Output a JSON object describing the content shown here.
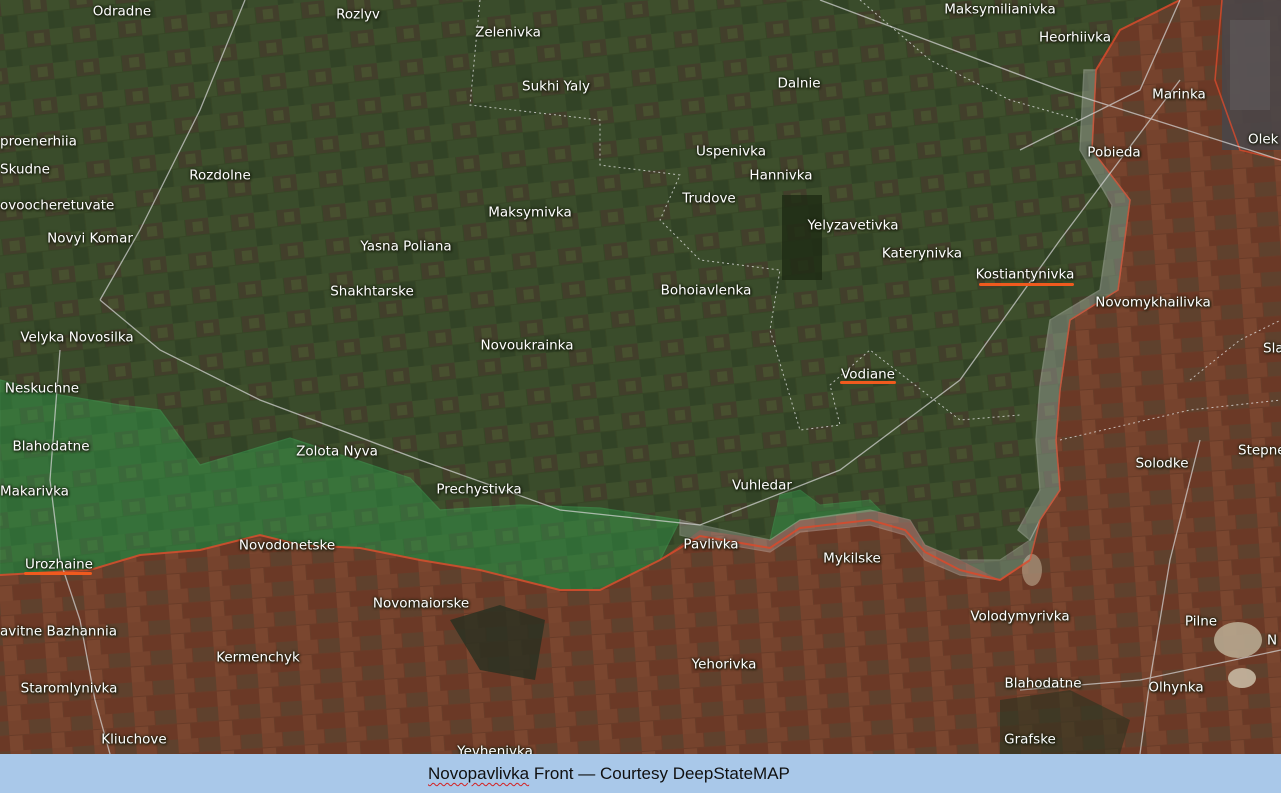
{
  "caption": {
    "emphasis": "Novopavlivka",
    "rest": " Front — Courtesy DeepStateMAP"
  },
  "colors": {
    "occupied_red": "#c9402c",
    "liberated_green": "#31c25a",
    "contested_grey": "#9a9a9a",
    "highlight_underline": "#f05a1e",
    "caption_background": "#a9c8e9"
  },
  "places": [
    {
      "id": "odradne",
      "name": "Odradne"
    },
    {
      "id": "rozlyv",
      "name": "Rozlyv"
    },
    {
      "id": "zelenivka",
      "name": "Zelenivka"
    },
    {
      "id": "maksymilianivka",
      "name": "Maksymilianivka"
    },
    {
      "id": "heorhiivka",
      "name": "Heorhiivka"
    },
    {
      "id": "sukhi-yaly",
      "name": "Sukhi Yaly"
    },
    {
      "id": "dalnie",
      "name": "Dalnie"
    },
    {
      "id": "marinka",
      "name": "Marinka"
    },
    {
      "id": "prosenerhiia",
      "name": "proenerhiia"
    },
    {
      "id": "olek",
      "name": "Olek"
    },
    {
      "id": "uspenivka",
      "name": "Uspenivka"
    },
    {
      "id": "pobieda",
      "name": "Pobieda"
    },
    {
      "id": "skudne",
      "name": "Skudne"
    },
    {
      "id": "rozdolne",
      "name": "Rozdolne"
    },
    {
      "id": "hannivka",
      "name": "Hannivka"
    },
    {
      "id": "trudove",
      "name": "Trudove"
    },
    {
      "id": "novoocheretuvate",
      "name": "ovoocheretuvate"
    },
    {
      "id": "maksymivka",
      "name": "Maksymivka"
    },
    {
      "id": "yelyzavetivka",
      "name": "Yelyzavetivka"
    },
    {
      "id": "novyi-komar",
      "name": "Novyi Komar"
    },
    {
      "id": "yasna-poliana",
      "name": "Yasna Poliana"
    },
    {
      "id": "katerynivka",
      "name": "Katerynivka"
    },
    {
      "id": "kostiantynivka",
      "name": "Kostiantynivka"
    },
    {
      "id": "shakhtarske",
      "name": "Shakhtarske"
    },
    {
      "id": "bohoiavlenka",
      "name": "Bohoiavlenka"
    },
    {
      "id": "novomykhailivka",
      "name": "Novomykhailivka"
    },
    {
      "id": "velyka-novosilka",
      "name": "Velyka Novosilka"
    },
    {
      "id": "novoukrainka",
      "name": "Novoukrainka"
    },
    {
      "id": "sla",
      "name": "Sla"
    },
    {
      "id": "vodiane",
      "name": "Vodiane"
    },
    {
      "id": "neskuchne",
      "name": "Neskuchne"
    },
    {
      "id": "blahodatne-west",
      "name": "Blahodatne"
    },
    {
      "id": "zolota-nyva",
      "name": "Zolota Nyva"
    },
    {
      "id": "solodke",
      "name": "Solodke"
    },
    {
      "id": "stepne",
      "name": "Stepne"
    },
    {
      "id": "prechystivka",
      "name": "Prechystivka"
    },
    {
      "id": "vuhledar",
      "name": "Vuhledar"
    },
    {
      "id": "makarivka",
      "name": "Makarivka"
    },
    {
      "id": "novodonetske",
      "name": "Novodonetske"
    },
    {
      "id": "pavlivka",
      "name": "Pavlivka"
    },
    {
      "id": "mykilske",
      "name": "Mykilske"
    },
    {
      "id": "urozhaine",
      "name": "Urozhaine"
    },
    {
      "id": "novomaiorske",
      "name": "Novomaiorske"
    },
    {
      "id": "volodymyrivka",
      "name": "Volodymyrivka"
    },
    {
      "id": "zavitne-bazhannia",
      "name": "avitne Bazhannia"
    },
    {
      "id": "pilne",
      "name": "Pilne"
    },
    {
      "id": "kermenchyk",
      "name": "Kermenchyk"
    },
    {
      "id": "yehorivka",
      "name": "Yehorivka"
    },
    {
      "id": "n",
      "name": "N"
    },
    {
      "id": "staromlynivka",
      "name": "Staromlynivka"
    },
    {
      "id": "blahodatne-east",
      "name": "Blahodatne"
    },
    {
      "id": "olhynka",
      "name": "Olhynka"
    },
    {
      "id": "kliuchove",
      "name": "Kliuchove"
    },
    {
      "id": "grafske",
      "name": "Grafske"
    },
    {
      "id": "yevhenivka",
      "name": "Yevhenivka"
    }
  ],
  "highlighted_places": [
    "Kostiantynivka",
    "Vodiane",
    "Urozhaine"
  ]
}
